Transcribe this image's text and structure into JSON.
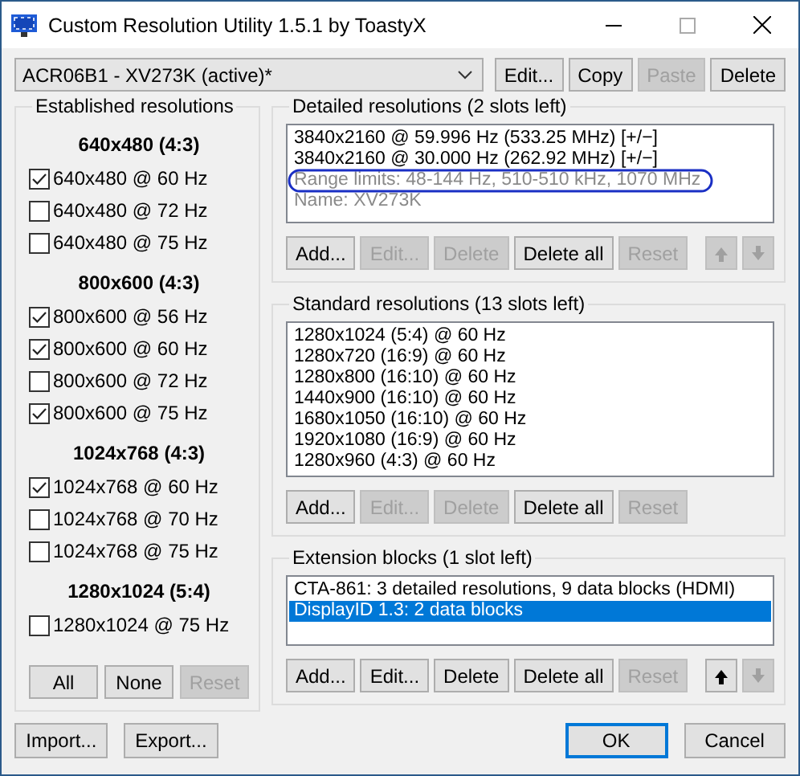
{
  "window": {
    "title": "Custom Resolution Utility 1.5.1 by ToastyX"
  },
  "monitor_select": {
    "value": "ACR06B1 - XV273K (active)*"
  },
  "monitor_buttons": [
    {
      "label": "Edit...",
      "disabled": false
    },
    {
      "label": "Copy",
      "disabled": false
    },
    {
      "label": "Paste",
      "disabled": true
    },
    {
      "label": "Delete",
      "disabled": false
    }
  ],
  "established": {
    "title": "Established resolutions",
    "groups": [
      {
        "heading": "640x480 (4:3)",
        "items": [
          {
            "label": "640x480 @ 60 Hz",
            "checked": true
          },
          {
            "label": "640x480 @ 72 Hz",
            "checked": false
          },
          {
            "label": "640x480 @ 75 Hz",
            "checked": false
          }
        ]
      },
      {
        "heading": "800x600 (4:3)",
        "items": [
          {
            "label": "800x600 @ 56 Hz",
            "checked": true
          },
          {
            "label": "800x600 @ 60 Hz",
            "checked": true
          },
          {
            "label": "800x600 @ 72 Hz",
            "checked": false
          },
          {
            "label": "800x600 @ 75 Hz",
            "checked": true
          }
        ]
      },
      {
        "heading": "1024x768 (4:3)",
        "items": [
          {
            "label": "1024x768 @ 60 Hz",
            "checked": true
          },
          {
            "label": "1024x768 @ 70 Hz",
            "checked": false
          },
          {
            "label": "1024x768 @ 75 Hz",
            "checked": false
          }
        ]
      },
      {
        "heading": "1280x1024 (5:4)",
        "items": [
          {
            "label": "1280x1024 @ 75 Hz",
            "checked": false
          }
        ]
      }
    ],
    "buttons": [
      {
        "label": "All",
        "disabled": false
      },
      {
        "label": "None",
        "disabled": false
      },
      {
        "label": "Reset",
        "disabled": true
      }
    ]
  },
  "detailed": {
    "title": "Detailed resolutions (2 slots left)",
    "items": [
      {
        "text": "3840x2160 @ 59.996 Hz (533.25 MHz) [+/−]",
        "kind": "entry",
        "selected": false
      },
      {
        "text": "3840x2160 @ 30.000 Hz (262.92 MHz) [+/−]",
        "kind": "entry",
        "selected": false
      },
      {
        "text": "Range limits: 48-144 Hz, 510-510 kHz, 1070 MHz",
        "kind": "info",
        "selected": false
      },
      {
        "text": "Name: XV273K",
        "kind": "info",
        "selected": false
      }
    ],
    "buttons": [
      {
        "label": "Add...",
        "disabled": false
      },
      {
        "label": "Edit...",
        "disabled": true
      },
      {
        "label": "Delete",
        "disabled": true
      },
      {
        "label": "Delete all",
        "disabled": false
      },
      {
        "label": "Reset",
        "disabled": true
      }
    ],
    "move_buttons": [
      {
        "kind": "up",
        "disabled": true
      },
      {
        "kind": "down",
        "disabled": true
      }
    ]
  },
  "standard": {
    "title": "Standard resolutions (13 slots left)",
    "items": [
      {
        "text": "1280x1024 (5:4) @ 60 Hz",
        "selected": false
      },
      {
        "text": "1280x720 (16:9) @ 60 Hz",
        "selected": false
      },
      {
        "text": "1280x800 (16:10) @ 60 Hz",
        "selected": false
      },
      {
        "text": "1440x900 (16:10) @ 60 Hz",
        "selected": false
      },
      {
        "text": "1680x1050 (16:10) @ 60 Hz",
        "selected": false
      },
      {
        "text": "1920x1080 (16:9) @ 60 Hz",
        "selected": false
      },
      {
        "text": "1280x960 (4:3) @ 60 Hz",
        "selected": false
      }
    ],
    "buttons": [
      {
        "label": "Add...",
        "disabled": false
      },
      {
        "label": "Edit...",
        "disabled": true
      },
      {
        "label": "Delete",
        "disabled": true
      },
      {
        "label": "Delete all",
        "disabled": false
      },
      {
        "label": "Reset",
        "disabled": true
      }
    ]
  },
  "extension": {
    "title": "Extension blocks (1 slot left)",
    "items": [
      {
        "text": "CTA-861: 3 detailed resolutions, 9 data blocks (HDMI)",
        "selected": false
      },
      {
        "text": "DisplayID 1.3: 2 data blocks",
        "selected": true
      }
    ],
    "buttons": [
      {
        "label": "Add...",
        "disabled": false
      },
      {
        "label": "Edit...",
        "disabled": false
      },
      {
        "label": "Delete",
        "disabled": false
      },
      {
        "label": "Delete all",
        "disabled": false
      },
      {
        "label": "Reset",
        "disabled": true
      }
    ],
    "move_buttons": [
      {
        "kind": "up",
        "disabled": false
      },
      {
        "kind": "down",
        "disabled": true
      }
    ]
  },
  "footer_buttons": [
    {
      "label": "Import...",
      "default": false
    },
    {
      "label": "Export...",
      "default": false
    },
    {
      "label": "OK",
      "default": true
    },
    {
      "label": "Cancel",
      "default": false
    }
  ]
}
